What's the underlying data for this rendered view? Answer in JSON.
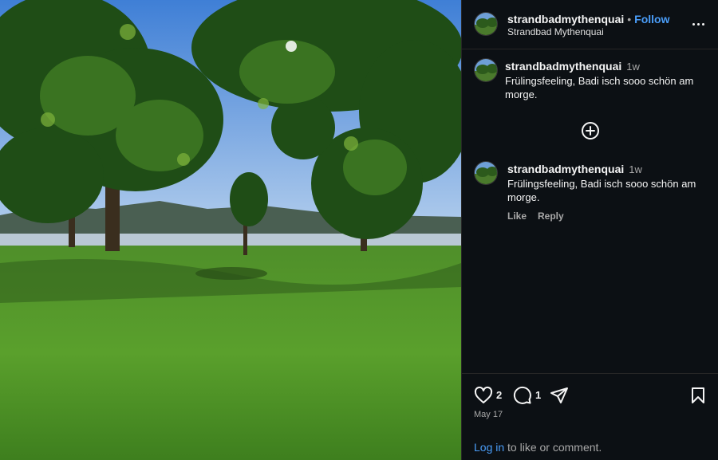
{
  "post": {
    "image_alt": "Park lawn with trees by a lake",
    "username": "strandbadmythenquai",
    "follow_label": "Follow",
    "location": "Strandbad Mythenquai"
  },
  "caption": {
    "username": "strandbadmythenquai",
    "time": "1w",
    "text": "Frülingsfeeling, Badi isch sooo schön am morge."
  },
  "comment": {
    "username": "strandbadmythenquai",
    "time": "1w",
    "text": "Frülingsfeeling, Badi isch sooo schön am morge.",
    "like_label": "Like",
    "reply_label": "Reply"
  },
  "actions": {
    "like_count": "2",
    "comment_count": "1",
    "date": "May 17",
    "login_link": "Log in",
    "login_suffix": " to like or comment."
  },
  "colors": {
    "accent": "#4a9df8",
    "background": "#0c1014",
    "muted": "#a8a8a8"
  }
}
